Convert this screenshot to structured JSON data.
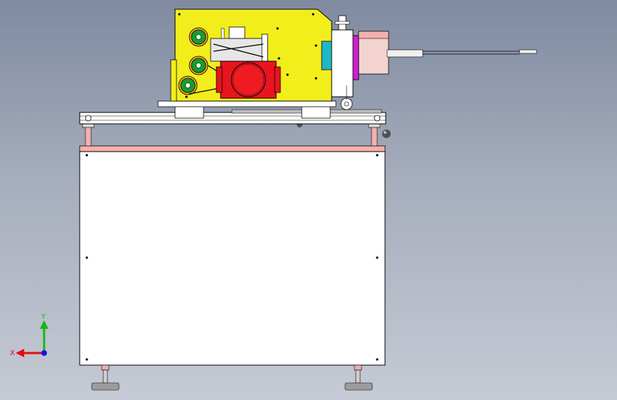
{
  "viewport": {
    "name": "cad-3d-viewport",
    "triad": {
      "x_label": "X",
      "y_label": "Y"
    }
  },
  "colors": {
    "background_top": "#7f8aa1",
    "background_bottom": "#c5cad4",
    "housing_yellow": "#f2ee1c",
    "motor_red": "#e8141e",
    "roller_green": "#16a02a",
    "roller_orange": "#e9a12a",
    "slider_cyan": "#1fb7c4",
    "slider_magenta": "#d01fd0",
    "support_pink": "#f3b1ac",
    "cabinet_white": "#ffffff",
    "axis_x_red": "#e01010",
    "axis_y_green": "#14b814",
    "axis_z_blue": "#1515e6"
  },
  "icons": [
    "coordinate-triad-icon"
  ]
}
